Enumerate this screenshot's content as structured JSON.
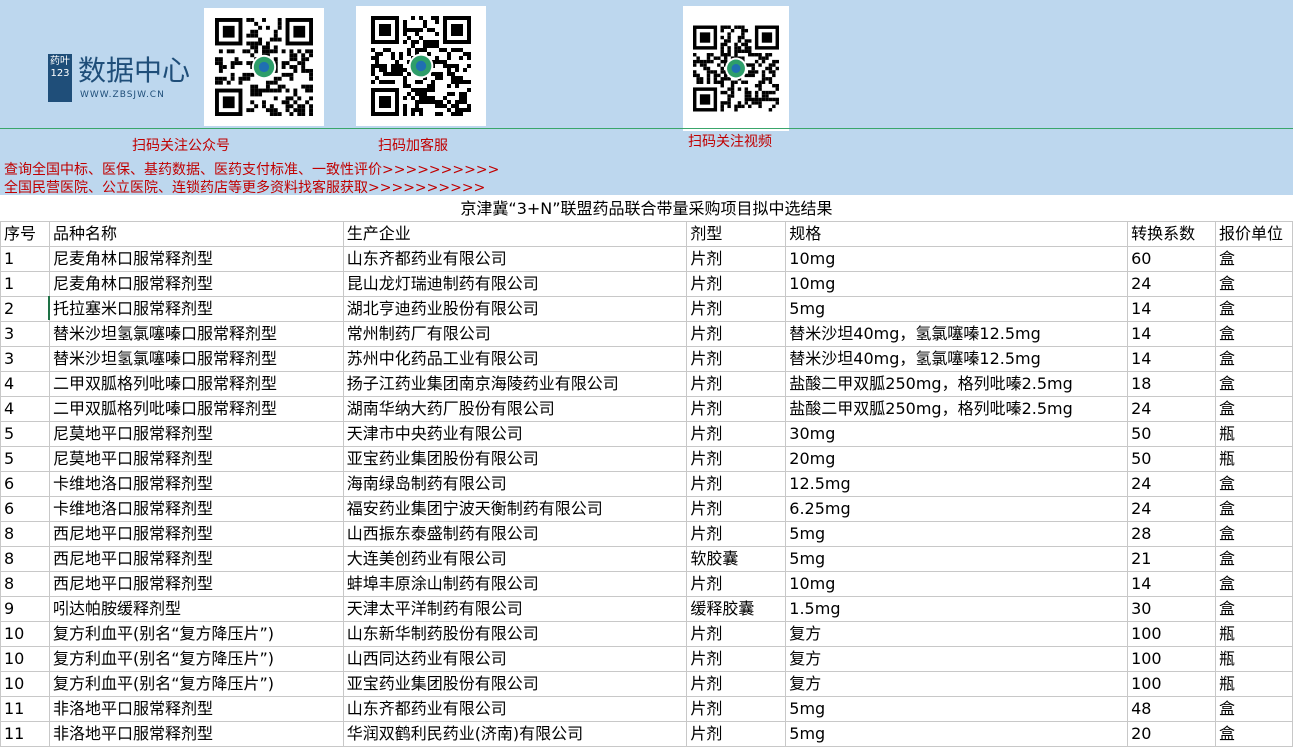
{
  "header": {
    "logo": {
      "mark": "药叶123",
      "name": "数据中心",
      "url": "WWW.ZBSJW.CN"
    },
    "qr_captions": [
      "扫码关注公众号",
      "扫码加客服",
      "扫码关注视频"
    ],
    "info_lines": [
      "查询全国中标、医保、基药数据、医药支付标准、一致性评价>>>>>>>>>>",
      "全国民营医院、公立医院、连锁药店等更多资料找客服获取>>>>>>>>>>"
    ]
  },
  "sheet": {
    "title": "京津冀“3+N”联盟药品联合带量采购项目拟中选结果",
    "columns": [
      "序号",
      "品种名称",
      "生产企业",
      "剂型",
      "规格",
      "转换系数",
      "报价单位"
    ],
    "rows": [
      [
        "1",
        "尼麦角林口服常释剂型",
        "山东齐都药业有限公司",
        "片剂",
        "10mg",
        "60",
        "盒"
      ],
      [
        "1",
        "尼麦角林口服常释剂型",
        "昆山龙灯瑞迪制药有限公司",
        "片剂",
        "10mg",
        "24",
        "盒"
      ],
      [
        "2",
        "托拉塞米口服常释剂型",
        "湖北亨迪药业股份有限公司",
        "片剂",
        "5mg",
        "14",
        "盒"
      ],
      [
        "3",
        "替米沙坦氢氯噻嗪口服常释剂型",
        "常州制药厂有限公司",
        "片剂",
        "替米沙坦40mg，氢氯噻嗪12.5mg",
        "14",
        "盒"
      ],
      [
        "3",
        "替米沙坦氢氯噻嗪口服常释剂型",
        "苏州中化药品工业有限公司",
        "片剂",
        "替米沙坦40mg，氢氯噻嗪12.5mg",
        "14",
        "盒"
      ],
      [
        "4",
        "二甲双胍格列吡嗪口服常释剂型",
        "扬子江药业集团南京海陵药业有限公司",
        "片剂",
        "盐酸二甲双胍250mg，格列吡嗪2.5mg",
        "18",
        "盒"
      ],
      [
        "4",
        "二甲双胍格列吡嗪口服常释剂型",
        "湖南华纳大药厂股份有限公司",
        "片剂",
        "盐酸二甲双胍250mg，格列吡嗪2.5mg",
        "24",
        "盒"
      ],
      [
        "5",
        "尼莫地平口服常释剂型",
        "天津市中央药业有限公司",
        "片剂",
        "30mg",
        "50",
        "瓶"
      ],
      [
        "5",
        "尼莫地平口服常释剂型",
        "亚宝药业集团股份有限公司",
        "片剂",
        "20mg",
        "50",
        "瓶"
      ],
      [
        "6",
        "卡维地洛口服常释剂型",
        "海南绿岛制药有限公司",
        "片剂",
        "12.5mg",
        "24",
        "盒"
      ],
      [
        "6",
        "卡维地洛口服常释剂型",
        "福安药业集团宁波天衡制药有限公司",
        "片剂",
        "6.25mg",
        "24",
        "盒"
      ],
      [
        "8",
        "西尼地平口服常释剂型",
        "山西振东泰盛制药有限公司",
        "片剂",
        "5mg",
        "28",
        "盒"
      ],
      [
        "8",
        "西尼地平口服常释剂型",
        "大连美创药业有限公司",
        "软胶囊",
        "5mg",
        "21",
        "盒"
      ],
      [
        "8",
        "西尼地平口服常释剂型",
        "蚌埠丰原涂山制药有限公司",
        "片剂",
        "10mg",
        "14",
        "盒"
      ],
      [
        "9",
        "吲达帕胺缓释剂型",
        "天津太平洋制药有限公司",
        "缓释胶囊",
        "1.5mg",
        "30",
        "盒"
      ],
      [
        "10",
        "复方利血平(别名“复方降压片”)",
        "山东新华制药股份有限公司",
        "片剂",
        "复方",
        "100",
        "瓶"
      ],
      [
        "10",
        "复方利血平(别名“复方降压片”)",
        "山西同达药业有限公司",
        "片剂",
        "复方",
        "100",
        "瓶"
      ],
      [
        "10",
        "复方利血平(别名“复方降压片”)",
        "亚宝药业集团股份有限公司",
        "片剂",
        "复方",
        "100",
        "瓶"
      ],
      [
        "11",
        "非洛地平口服常释剂型",
        "山东齐都药业有限公司",
        "片剂",
        "5mg",
        "48",
        "盒"
      ],
      [
        "11",
        "非洛地平口服常释剂型",
        "华润双鹤利民药业(济南)有限公司",
        "片剂",
        "5mg",
        "20",
        "盒"
      ]
    ]
  }
}
